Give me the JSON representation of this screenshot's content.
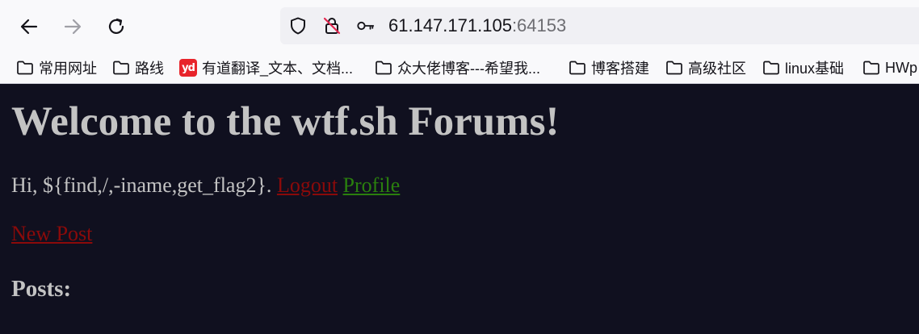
{
  "browser": {
    "url_host": "61.147.171.105",
    "url_port": ":64153",
    "bookmarks": [
      {
        "label": "常用网址",
        "icon": "folder-icon"
      },
      {
        "label": "路线",
        "icon": "folder-icon"
      },
      {
        "label": "有道翻译_文本、文档...",
        "icon": "youdao-icon"
      },
      {
        "label": "众大佬博客---希望我...",
        "icon": "folder-icon"
      },
      {
        "label": "博客搭建",
        "icon": "folder-icon"
      },
      {
        "label": "高级社区",
        "icon": "folder-icon"
      },
      {
        "label": "linux基础",
        "icon": "folder-icon"
      },
      {
        "label": "HWp",
        "icon": "folder-icon"
      }
    ],
    "youdao_icon_text": "yd"
  },
  "page": {
    "title": "Welcome to the wtf.sh Forums!",
    "greeting_prefix": "Hi, ${find,/,-iname,get_flag2}.",
    "logout_label": "Logout",
    "profile_label": "Profile",
    "new_post_label": "New Post",
    "posts_heading": "Posts:"
  },
  "colors": {
    "page_background": "#10101f",
    "text": "#c3c3c3",
    "link_red": "#8b0a0a",
    "link_green": "#2a7f0e"
  }
}
